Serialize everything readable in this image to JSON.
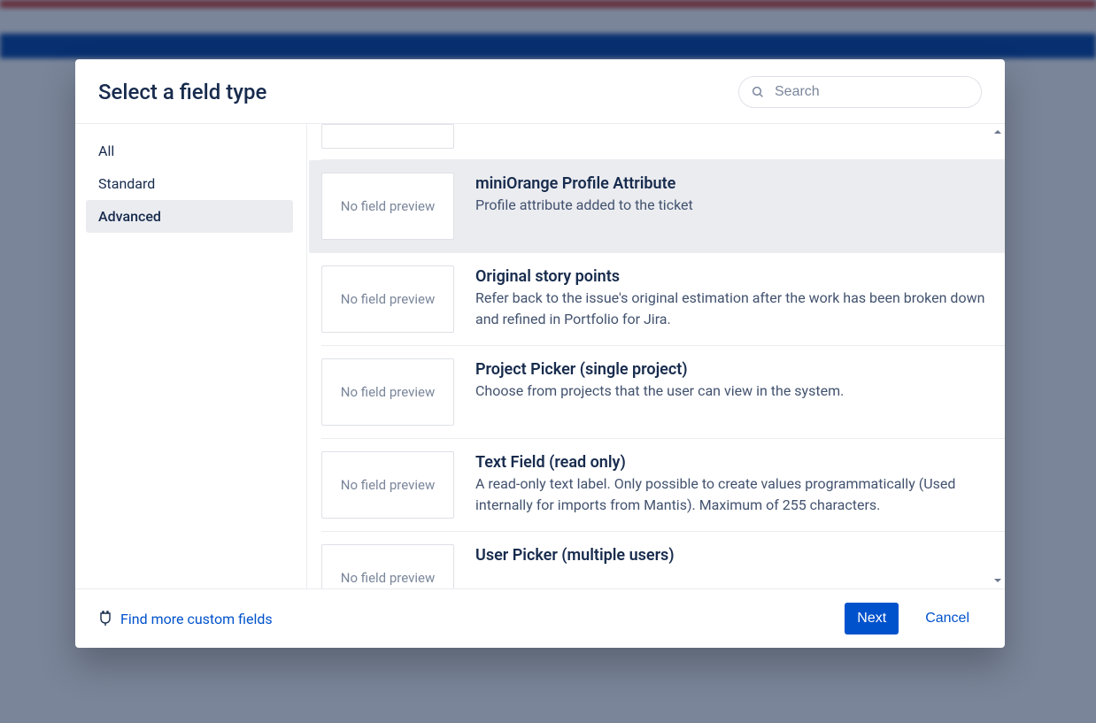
{
  "header": {
    "title": "Select a field type",
    "search_placeholder": "Search"
  },
  "sidebar": {
    "items": [
      {
        "label": "All",
        "selected": false
      },
      {
        "label": "Standard",
        "selected": false
      },
      {
        "label": "Advanced",
        "selected": true
      }
    ]
  },
  "field_types": {
    "preview_placeholder": "No field preview",
    "items": [
      {
        "title": "miniOrange Profile Attribute",
        "description": "Profile attribute added to the ticket",
        "selected": true
      },
      {
        "title": "Original story points",
        "description": "Refer back to the issue's original estimation after the work has been broken down and refined in Portfolio for Jira.",
        "selected": false
      },
      {
        "title": "Project Picker (single project)",
        "description": "Choose from projects that the user can view in the system.",
        "selected": false
      },
      {
        "title": "Text Field (read only)",
        "description": "A read-only text label. Only possible to create values programmatically (Used internally for imports from Mantis). Maximum of 255 characters.",
        "selected": false
      },
      {
        "title": "User Picker (multiple users)",
        "description": "",
        "selected": false
      }
    ]
  },
  "footer": {
    "find_more_label": "Find more custom fields",
    "next_label": "Next",
    "cancel_label": "Cancel"
  }
}
